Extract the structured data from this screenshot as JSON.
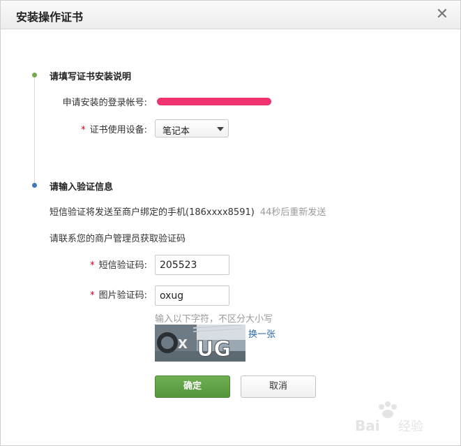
{
  "dialog": {
    "title": "安装操作证书",
    "close_glyph": "✕"
  },
  "section1": {
    "title": "请填写证书安装说明",
    "account_label": "申请安装的登录帐号:",
    "device_label": "证书使用设备:",
    "device_required": "*",
    "device_value": "笔记本"
  },
  "section2": {
    "title": "请输入验证信息",
    "sms_notice": "短信验证将发送至商户绑定的手机(186xxxx8591)",
    "resend_text": "44秒后重新发送",
    "contact_notice": "请联系您的商户管理员获取验证码",
    "sms_label": "短信验证码:",
    "sms_required": "*",
    "sms_value": "205523",
    "image_label": "图片验证码:",
    "image_required": "*",
    "image_value": "oxug",
    "captcha_hint": "输入以下字符，不区分大小写",
    "captcha_refresh": "换一张",
    "captcha_text": "UG"
  },
  "buttons": {
    "confirm": "确定",
    "cancel": "取消"
  },
  "watermark": {
    "text": "Bai 经验"
  },
  "colors": {
    "primary": "#5fa246",
    "link": "#2f6aa8",
    "required": "#d0021b",
    "redaction": "#f0336f"
  }
}
